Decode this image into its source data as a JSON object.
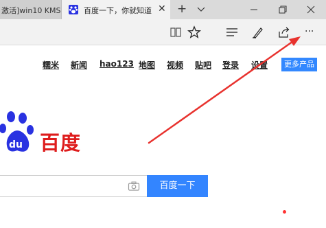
{
  "browser": {
    "tabs": [
      {
        "title": "激活]win10 KMS",
        "active": false
      },
      {
        "title": "百度一下，你就知道",
        "active": true
      }
    ],
    "close_glyph": "✕",
    "new_tab_glyph": "+",
    "window_controls": [
      "minimize",
      "maximize",
      "close"
    ],
    "toolbar_icons": [
      "reading-view-icon",
      "favorite-star-icon",
      "hub-icon",
      "web-note-icon",
      "share-icon",
      "more-actions-icon"
    ],
    "more_label": "···"
  },
  "page": {
    "top_links": [
      "糯米",
      "新闻",
      "hao123",
      "地图",
      "视频",
      "贴吧",
      "登录",
      "设置"
    ],
    "more_products": "更多产品",
    "logo_text": "百度",
    "search_value": "",
    "search_button": "百度一下"
  },
  "colors": {
    "annotation_arrow": "#e8322e",
    "search_button": "#3385ff",
    "logo_red": "#de1d1d",
    "logo_blue": "#2932e1"
  }
}
